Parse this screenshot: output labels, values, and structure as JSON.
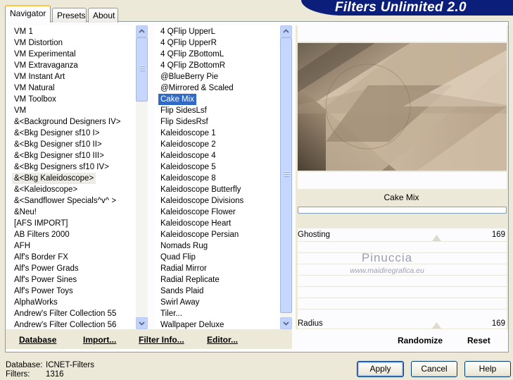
{
  "window": {
    "banner_title": "Filters Unlimited 2.0"
  },
  "tabs": [
    {
      "label": "Navigator"
    },
    {
      "label": "Presets"
    },
    {
      "label": "About"
    }
  ],
  "categories": [
    "VM 1",
    "VM Distortion",
    "VM Experimental",
    "VM Extravaganza",
    "VM Instant Art",
    "VM Natural",
    "VM Toolbox",
    "VM",
    "&<Background Designers IV>",
    "&<Bkg Designer sf10 I>",
    "&<Bkg Designer sf10 II>",
    "&<Bkg Designer sf10 III>",
    "&<Bkg Designers sf10 IV>",
    "&<Bkg Kaleidoscope>",
    "&<Kaleidoscope>",
    "&<Sandflower Specials^v^ >",
    "&Neu!",
    "[AFS IMPORT]",
    "AB Filters 2000",
    "AFH",
    "Alf's Border FX",
    "Alf's Power Grads",
    "Alf's Power Sines",
    "Alf's Power Toys",
    "AlphaWorks",
    "Andrew's Filter Collection 55",
    "Andrew's Filter Collection 56"
  ],
  "filters": [
    "4 QFlip UpperL",
    "4 QFlip UpperR",
    "4 QFlip ZBottomL",
    "4 QFlip ZBottomR",
    "@BlueBerry Pie",
    "@Mirrored & Scaled",
    "Cake Mix",
    "Flip SidesLsf",
    "Flip SidesRsf",
    "Kaleidoscope 1",
    "Kaleidoscope 2",
    "Kaleidoscope 4",
    "Kaleidoscope 5",
    "Kaleidoscope 8",
    "Kaleidoscope Butterfly",
    "Kaleidoscope Divisions",
    "Kaleidoscope Flower",
    "Kaleidoscope Heart",
    "Kaleidoscope Persian",
    "Nomads Rug",
    "Quad Flip",
    "Radial Mirror",
    "Radial Replicate",
    "Sands Plaid",
    "Swirl Away",
    "Tiler...",
    "Wallpaper Deluxe"
  ],
  "category_highlighted": "&<Bkg Kaleidoscope>",
  "filter_selected": "Cake Mix",
  "bottom_links": {
    "database": "Database",
    "import": "Import...",
    "filter_info": "Filter Info...",
    "editor": "Editor..."
  },
  "filter_panel": {
    "title": "Cake Mix",
    "params": [
      {
        "label": "Ghosting",
        "value": "169"
      },
      {
        "label": "Radius",
        "value": "169"
      }
    ],
    "randomize": "Randomize",
    "reset": "Reset"
  },
  "watermark": {
    "line1": "Pinuccia",
    "line2": "www.maidiregrafica.eu"
  },
  "status": {
    "database_label": "Database:",
    "database_value": "ICNET-Filters",
    "filters_label": "Filters:",
    "filters_value": "1316"
  },
  "buttons": {
    "apply": "Apply",
    "cancel": "Cancel",
    "help": "Help"
  },
  "colors": {
    "banner": "#0b1e7a",
    "selection": "#316ac5",
    "window_bg": "#ece9d8"
  }
}
